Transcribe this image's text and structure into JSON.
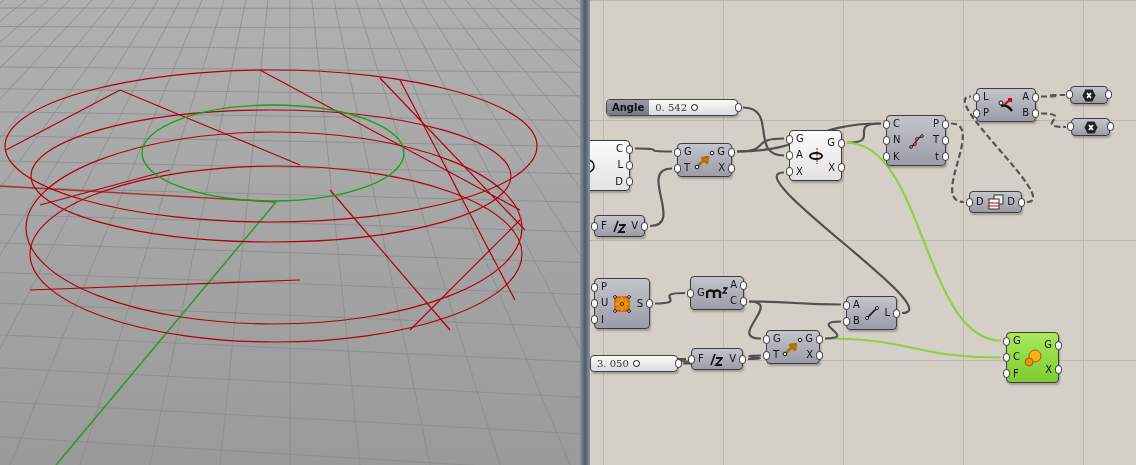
{
  "canvas": {
    "nodes": [
      {
        "kind": "slider",
        "label": "Angle",
        "value": "0. 542",
        "selected": false
      },
      {
        "kind": "component",
        "outputs": [
          "C",
          "L",
          "D"
        ],
        "selected": false,
        "preview": false
      },
      {
        "kind": "component",
        "inputs": [
          "G",
          "T"
        ],
        "outputs": [
          "G",
          "X"
        ],
        "selected": false,
        "preview": true
      },
      {
        "kind": "component",
        "inputs": [
          "F"
        ],
        "outputs": [
          "V"
        ],
        "selected": false,
        "preview": true
      },
      {
        "kind": "component",
        "inputs": [
          "G",
          "A",
          "X"
        ],
        "outputs": [
          "G",
          "X"
        ],
        "selected": false,
        "preview": false
      },
      {
        "kind": "component",
        "inputs": [
          "C",
          "N",
          "K"
        ],
        "outputs": [
          "P",
          "T",
          "t"
        ],
        "selected": false,
        "preview": true
      },
      {
        "kind": "component",
        "inputs": [
          "L",
          "P"
        ],
        "outputs": [
          "A",
          "B"
        ],
        "selected": false,
        "preview": true
      },
      {
        "kind": "hex",
        "selected": false,
        "preview": true
      },
      {
        "kind": "hex",
        "selected": false,
        "preview": true
      },
      {
        "kind": "component",
        "inputs": [
          "D"
        ],
        "outputs": [
          "D"
        ],
        "selected": false,
        "preview": true
      },
      {
        "kind": "component",
        "inputs": [
          "P",
          "U",
          "I"
        ],
        "outputs": [
          "S"
        ],
        "selected": false,
        "preview": true
      },
      {
        "kind": "component",
        "inputs": [
          "G"
        ],
        "outputs": [
          "A",
          "C"
        ],
        "selected": false,
        "preview": true
      },
      {
        "kind": "component",
        "inputs": [
          "A",
          "B"
        ],
        "outputs": [
          "L"
        ],
        "selected": false,
        "preview": true
      },
      {
        "kind": "component",
        "inputs": [
          "G",
          "T"
        ],
        "outputs": [
          "G",
          "X"
        ],
        "selected": false,
        "preview": true
      },
      {
        "kind": "slider",
        "value": "3. 050",
        "selected": false
      },
      {
        "kind": "component",
        "inputs": [
          "F"
        ],
        "outputs": [
          "V"
        ],
        "selected": false,
        "preview": true
      },
      {
        "kind": "component",
        "inputs": [
          "G",
          "C",
          "F"
        ],
        "outputs": [
          "G",
          "X"
        ],
        "selected": true,
        "preview": true
      }
    ]
  }
}
